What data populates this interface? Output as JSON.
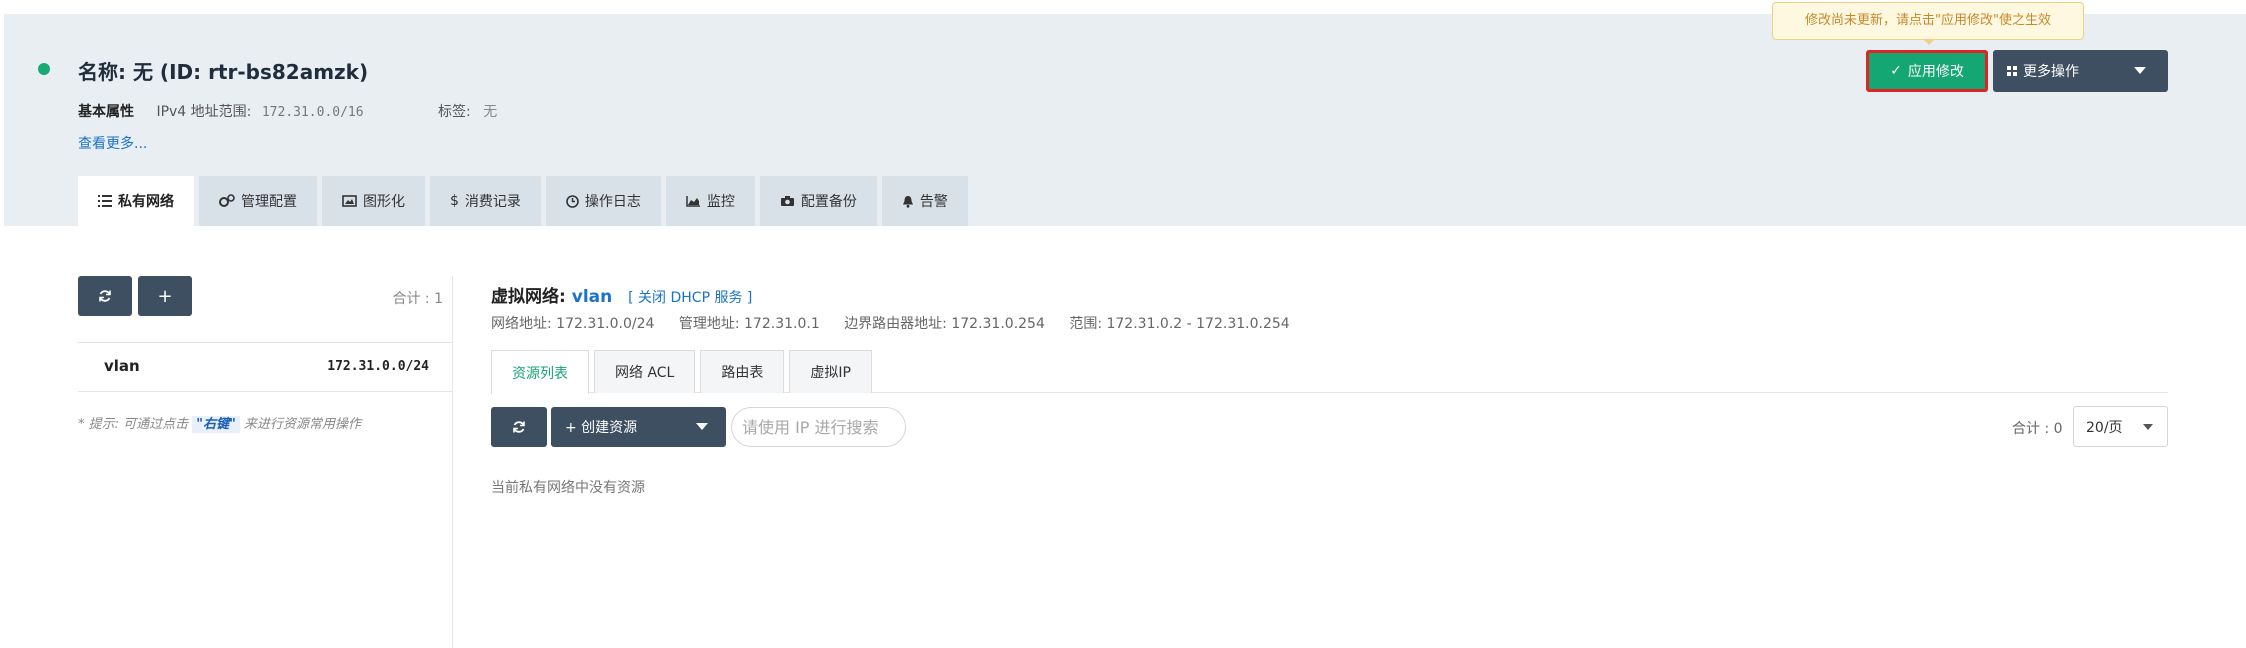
{
  "header": {
    "title": "名称: 无 (ID: rtr-bs82amzk)",
    "props_label": "基本属性",
    "ipv4_label": "IPv4 地址范围:",
    "ipv4_value": "172.31.0.0/16",
    "tags_label": "标签:",
    "tags_value": "无",
    "more_link": "查看更多...",
    "tooltip": "修改尚未更新，请点击\"应用修改\"使之生效",
    "apply_label": "应用修改",
    "more_ops_label": "更多操作"
  },
  "tabs": [
    {
      "label": "私有网络",
      "icon": "list-icon"
    },
    {
      "label": "管理配置",
      "icon": "gears-icon"
    },
    {
      "label": "图形化",
      "icon": "image-icon"
    },
    {
      "label": "消费记录",
      "icon": "dollar-icon"
    },
    {
      "label": "操作日志",
      "icon": "clock-icon"
    },
    {
      "label": "监控",
      "icon": "area-chart-icon"
    },
    {
      "label": "配置备份",
      "icon": "camera-icon"
    },
    {
      "label": "告警",
      "icon": "bell-icon"
    }
  ],
  "left": {
    "refresh_icon": "refresh-icon",
    "add_label": "+",
    "total": "合计 : 1",
    "vlans": [
      {
        "name": "vlan",
        "cidr": "172.31.0.0/24"
      }
    ],
    "hint_prefix": "* 提示: 可通过点击",
    "hint_keyword": "\"右键\"",
    "hint_suffix": "来进行资源常用操作"
  },
  "vnet": {
    "title_prefix": "虚拟网络:",
    "name": "vlan",
    "dhcp_link": "[ 关闭 DHCP 服务 ]",
    "net_addr": "网络地址: 172.31.0.0/24",
    "mgmt_addr": "管理地址: 172.31.0.1",
    "border_addr": "边界路由器地址: 172.31.0.254",
    "range": "范围: 172.31.0.2 - 172.31.0.254"
  },
  "subtabs": [
    "资源列表",
    "网络 ACL",
    "路由表",
    "虚拟IP"
  ],
  "toolbar": {
    "create_label": "+ 创建资源",
    "search_placeholder": "请使用 IP 进行搜索",
    "total": "合计 : 0",
    "page_size": "20/页"
  },
  "empty_text": "当前私有网络中没有资源",
  "colors": {
    "accent": "#14a673",
    "dark_button": "#3e4f61",
    "link": "#1a73c8",
    "header_bg": "#e9eef3"
  }
}
